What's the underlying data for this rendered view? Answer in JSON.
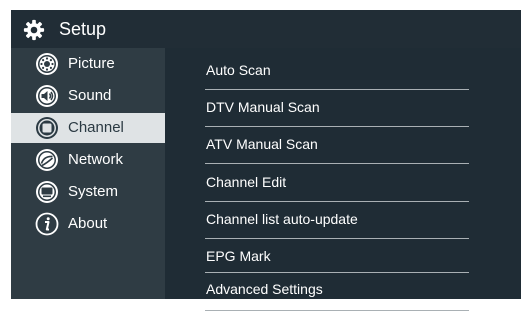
{
  "header": {
    "title": "Setup",
    "icon": "gear-icon"
  },
  "sidebar": {
    "items": [
      {
        "label": "Picture",
        "icon": "picture-settings-icon",
        "selected": false
      },
      {
        "label": "Sound",
        "icon": "speaker-icon",
        "selected": false
      },
      {
        "label": "Channel",
        "icon": "channel-icon",
        "selected": true
      },
      {
        "label": "Network",
        "icon": "network-icon",
        "selected": false
      },
      {
        "label": "System",
        "icon": "system-icon",
        "selected": false
      },
      {
        "label": "About",
        "icon": "info-icon",
        "selected": false
      }
    ]
  },
  "menu": {
    "items": [
      {
        "label": "Auto Scan"
      },
      {
        "label": "DTV Manual Scan"
      },
      {
        "label": "ATV Manual Scan"
      },
      {
        "label": "Channel Edit"
      },
      {
        "label": "Channel list auto-update"
      },
      {
        "label": "EPG Mark"
      },
      {
        "label": "Advanced Settings"
      }
    ]
  },
  "colors": {
    "screen_bg": "#1f2c35",
    "sidebar_bg": "#2f3c44",
    "selected_bg": "#dfe3e5",
    "selected_text": "#2b3a43",
    "divider": "#a9b0b4",
    "text": "#ffffff"
  }
}
